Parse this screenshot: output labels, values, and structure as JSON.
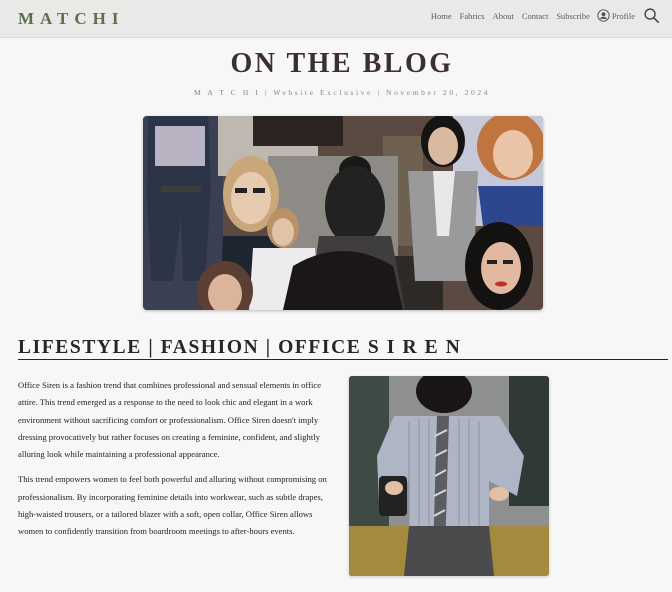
{
  "nav": {
    "brand": "MATCHI",
    "links": [
      "Home",
      "Fabrics",
      "About",
      "Contact",
      "Subscribe"
    ],
    "profile_label": "Profile",
    "profile_icon": "user-circle-icon",
    "search_icon": "search-icon"
  },
  "hero": {
    "title": "ON THE BLOG",
    "meta": "M A T C H I | Website Exclusive | November 20, 2024",
    "image": "collage of women in office attire"
  },
  "article": {
    "section_title": "LIFESTYLE | FASHION | OFFICE S I R E N",
    "paragraphs": [
      "Office Siren is a fashion trend that combines professional and sensual elements in office attire. This trend emerged as a response to the need to look chic and elegant in a work environment without sacrificing comfort or professionalism. Office Siren doesn't imply dressing provocatively but rather focuses on creating a feminine, confident, and slightly alluring look while maintaining a professional appearance.",
      "This trend empowers women to feel both powerful and alluring without compromising on professionalism. By incorporating feminine details into workwear, such as subtle drapes, high-waisted trousers, or a tailored blazer with a soft, open collar, Office Siren allows women to confidently transition from boardroom meetings to after-hours events."
    ],
    "side_image": "woman in striped shirt and loose tie"
  },
  "colors": {
    "brand": "#5e6f4c",
    "nav_bg": "#e9e9e8",
    "page_bg": "#f7f7f7",
    "heading": "#3b2f2f"
  }
}
